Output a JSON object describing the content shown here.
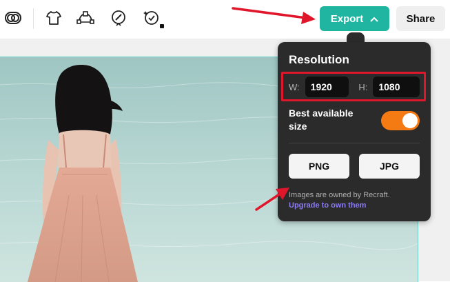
{
  "toolbar": {
    "icons": [
      "remove-background-icon",
      "tshirt-mockup-icon",
      "vectorize-icon",
      "edit-icon",
      "magic-edit-icon"
    ],
    "export_label": "Export",
    "share_label": "Share"
  },
  "export_popup": {
    "title": "Resolution",
    "width_label": "W:",
    "width_value": "1920",
    "height_label": "H:",
    "height_value": "1080",
    "best_size_label": "Best available size",
    "best_size_enabled": true,
    "png_label": "PNG",
    "jpg_label": "JPG",
    "ownership_note": "Images are owned by Recraft.",
    "upgrade_link": "Upgrade to own them"
  },
  "colors": {
    "accent": "#1fb5a0",
    "toggle_on": "#f47a14",
    "highlight": "#e0162b",
    "link": "#8a7cf0"
  }
}
